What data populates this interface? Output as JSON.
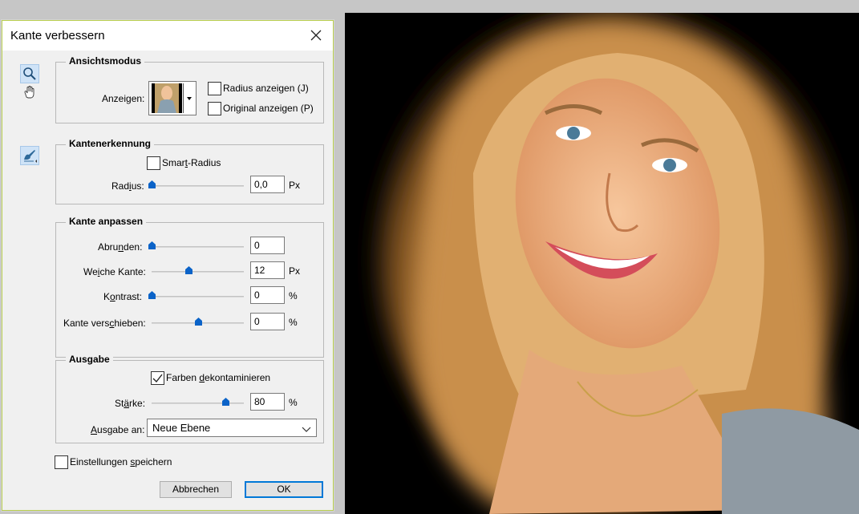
{
  "dialog": {
    "title": "Kante verbessern"
  },
  "view_mode": {
    "legend": "Ansichtsmodus",
    "show_label": "Anzeigen:",
    "radius_show": "Radius anzeigen (J)",
    "original_show": "Original anzeigen (P)"
  },
  "edge_detection": {
    "legend": "Kantenerkennung",
    "smart_radius": "Smart-Radius",
    "radius_label": "Radius:",
    "radius_value": "0,0",
    "radius_unit": "Px",
    "radius_fraction": 0.0
  },
  "adjust_edge": {
    "legend": "Kante anpassen",
    "smooth_label": "Abrunden:",
    "smooth_value": "0",
    "smooth_fraction": 0.0,
    "feather_label": "Weiche Kante:",
    "feather_value": "12",
    "feather_unit": "Px",
    "feather_fraction": 0.4,
    "contrast_label": "Kontrast:",
    "contrast_value": "0",
    "contrast_unit": "%",
    "contrast_fraction": 0.0,
    "shift_label": "Kante verschieben:",
    "shift_value": "0",
    "shift_unit": "%",
    "shift_fraction": 0.5
  },
  "output": {
    "legend": "Ausgabe",
    "decontaminate": "Farben dekontaminieren",
    "decontaminate_checked": true,
    "amount_label": "Stärke:",
    "amount_value": "80",
    "amount_unit": "%",
    "amount_fraction": 0.8,
    "output_to_label": "Ausgabe an:",
    "output_to_value": "Neue Ebene"
  },
  "footer": {
    "remember": "Einstellungen speichern",
    "cancel": "Abbrechen",
    "ok": "OK"
  },
  "icons": {
    "zoom": "zoom-icon",
    "hand": "hand-icon",
    "refine_brush": "refine-radius-brush-icon",
    "close": "close-icon",
    "view_thumbnail": "view-thumbnail-icon",
    "dropdown": "chevron-down-icon"
  },
  "colors": {
    "accent": "#0078d7",
    "dialog_border": "#b9cf4e"
  }
}
